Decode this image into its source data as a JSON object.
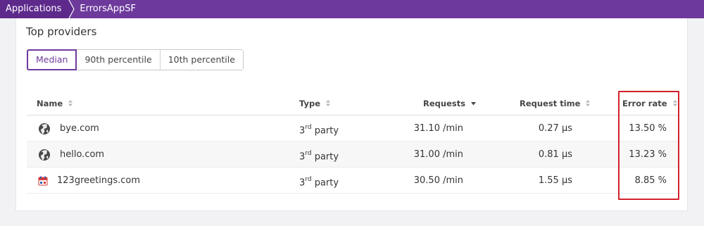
{
  "breadcrumb": {
    "items": [
      "Applications",
      "ErrorsAppSF"
    ]
  },
  "card": {
    "title": "Top providers"
  },
  "tabs": [
    {
      "label": "Median",
      "active": true
    },
    {
      "label": "90th percentile",
      "active": false
    },
    {
      "label": "10th percentile",
      "active": false
    }
  ],
  "table": {
    "columns": [
      "Name",
      "Type",
      "Requests",
      "Request time",
      "Error rate"
    ],
    "rows": [
      {
        "icon": "globe-icon",
        "name": "bye.com",
        "type_base": "3",
        "type_sup": "rd",
        "type_word": "party",
        "requests": "31.10 /min",
        "request_time": "0.27 µs",
        "error_rate": "13.50 %"
      },
      {
        "icon": "globe-icon",
        "name": "hello.com",
        "type_base": "3",
        "type_sup": "rd",
        "type_word": "party",
        "requests": "31.00 /min",
        "request_time": "0.81 µs",
        "error_rate": "13.23 %"
      },
      {
        "icon": "calendar-favicon-icon",
        "name": "123greetings.com",
        "type_base": "3",
        "type_sup": "rd",
        "type_word": "party",
        "requests": "30.50 /min",
        "request_time": "1.55 µs",
        "error_rate": "8.85 %"
      }
    ]
  },
  "colors": {
    "brand": "#6d3a9c",
    "highlight": "#d3212c"
  }
}
